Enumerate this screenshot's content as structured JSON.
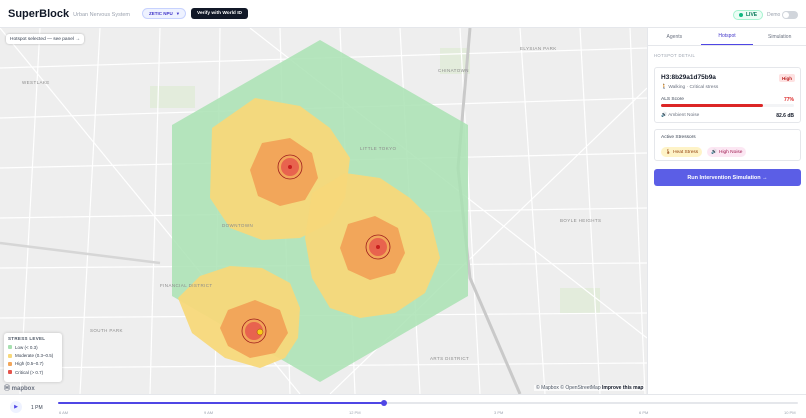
{
  "header": {
    "brand": "SuperBlock",
    "subtitle": "Urban Nervous System",
    "token_label": "ZETIC NPU",
    "verify_label": "Verify with World ID",
    "live_label": "LIVE",
    "demo_label": "Demo"
  },
  "map": {
    "hotspot_status": "Hotspot selected — see panel →",
    "district_labels": [
      "WESTLAKE",
      "DOWNTOWN",
      "ARTS DISTRICT",
      "BOYLE HEIGHTS",
      "LITTLE TOKYO",
      "CHINATOWN",
      "ELYSIAN PARK",
      "SOUTH PARK",
      "FINANCIAL DISTRICT"
    ],
    "legend": {
      "title": "STRESS LEVEL",
      "items": [
        {
          "label": "Low (< 0.3)",
          "color": "#a7e0b0"
        },
        {
          "label": "Moderate (0.3–0.5)",
          "color": "#f7d87a"
        },
        {
          "label": "High (0.5–0.7)",
          "color": "#f2a65a"
        },
        {
          "label": "Critical (> 0.7)",
          "color": "#e5534b"
        }
      ]
    },
    "logo_text": "mapbox",
    "attribution_1": "© Mapbox © OpenStreetMap",
    "attribution_link": "Improve this map"
  },
  "timeline": {
    "current_time": "1 PM",
    "progress": 0.44,
    "ticks": [
      "6 AM",
      "9 AM",
      "12 PM",
      "3 PM",
      "6 PM",
      "10 PM"
    ]
  },
  "panel": {
    "tabs": [
      "Agents",
      "Hotspot",
      "Simulation"
    ],
    "active_tab": "Hotspot",
    "section_label": "HOTSPOT DETAIL",
    "hotspot": {
      "id": "H3:8b29a1d75b9a",
      "severity": "High",
      "mode": "Walking · Critical stress",
      "score_label": "ALS Score",
      "score_value": "77%",
      "score": 0.77,
      "noise_label": "Ambient Noise",
      "noise_value": "82.6 dB"
    },
    "stressors": {
      "title": "Active Stressors",
      "items": [
        "Heat Stress",
        "High Noise"
      ]
    },
    "run_button": "Run Intervention Simulation →"
  }
}
